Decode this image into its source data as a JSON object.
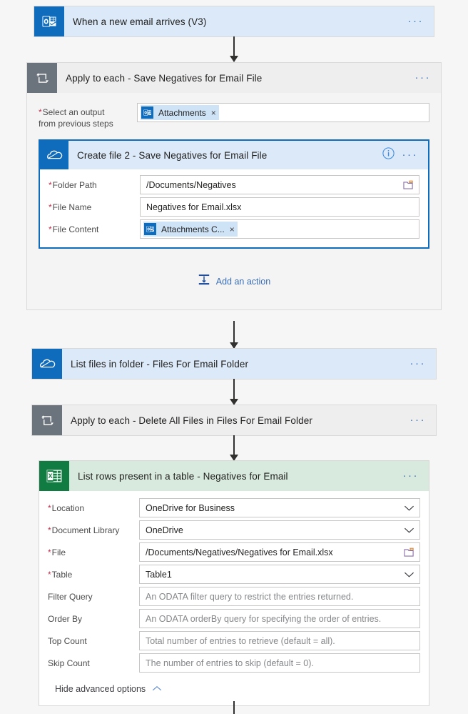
{
  "flow": {
    "trigger": {
      "title": "When a new email arrives (V3)",
      "icon": "outlook-icon",
      "more_label": "···"
    },
    "scope_save": {
      "title": "Apply to each - Save Negatives for Email File",
      "icon": "apply-to-each-icon",
      "more_label": "···",
      "select_output": {
        "label_line1": "Select an output",
        "label_line2": "from previous steps",
        "required": true,
        "token": {
          "text": "Attachments",
          "icon": "outlook-icon",
          "remove_label": "×"
        }
      },
      "inner_card": {
        "title": "Create file 2 - Save Negatives for Email File",
        "icon": "onedrive-icon",
        "info_label": "i",
        "more_label": "···",
        "fields": [
          {
            "label": "Folder Path",
            "required": true,
            "type": "text",
            "value": "/Documents/Negatives",
            "right_icon": "folder-picker-icon"
          },
          {
            "label": "File Name",
            "required": true,
            "type": "text",
            "value": "Negatives for Email.xlsx",
            "right_icon": ""
          },
          {
            "label": "File Content",
            "required": true,
            "type": "token",
            "token": {
              "text": "Attachments C...",
              "icon": "outlook-icon",
              "remove_label": "×"
            }
          }
        ]
      },
      "add_action": {
        "label": "Add an action",
        "icon": "add-action-icon"
      }
    },
    "list_files": {
      "title": "List files in folder - Files For Email Folder",
      "icon": "onedrive-icon",
      "more_label": "···"
    },
    "scope_delete": {
      "title": "Apply to each - Delete All Files in Files For Email Folder",
      "icon": "apply-to-each-icon",
      "more_label": "···"
    },
    "list_rows": {
      "title": "List rows present in a table - Negatives for Email",
      "icon": "excel-icon",
      "more_label": "···",
      "fields": [
        {
          "label": "Location",
          "required": true,
          "type": "select",
          "value": "OneDrive for Business",
          "right_icon": "chevron-down-icon"
        },
        {
          "label": "Document Library",
          "required": true,
          "type": "select",
          "value": "OneDrive",
          "right_icon": "chevron-down-icon"
        },
        {
          "label": "File",
          "required": true,
          "type": "text",
          "value": "/Documents/Negatives/Negatives for Email.xlsx",
          "right_icon": "folder-picker-icon"
        },
        {
          "label": "Table",
          "required": true,
          "type": "select",
          "value": "Table1",
          "right_icon": "chevron-down-icon"
        },
        {
          "label": "Filter Query",
          "required": false,
          "type": "text",
          "value": "",
          "placeholder": "An ODATA filter query to restrict the entries returned.",
          "right_icon": ""
        },
        {
          "label": "Order By",
          "required": false,
          "type": "text",
          "value": "",
          "placeholder": "An ODATA orderBy query for specifying the order of entries.",
          "right_icon": ""
        },
        {
          "label": "Top Count",
          "required": false,
          "type": "text",
          "value": "",
          "placeholder": "Total number of entries to retrieve (default = all).",
          "right_icon": ""
        },
        {
          "label": "Skip Count",
          "required": false,
          "type": "text",
          "value": "",
          "placeholder": "The number of entries to skip (default = 0).",
          "right_icon": ""
        }
      ],
      "advanced_toggle": {
        "label": "Hide advanced options",
        "icon": "chevron-up-icon"
      }
    }
  },
  "colors": {
    "trigger_header": "#dbe9f8",
    "scope_header": "#eeeeee",
    "excel_header": "#d7eadd",
    "outlook_blue": "#0f6cbd",
    "excel_green": "#107c41",
    "scope_icon_gray": "#6b737c",
    "required_red": "#c4314b",
    "link_blue": "#3b6fb6",
    "canvas": "#f6f6f6"
  }
}
